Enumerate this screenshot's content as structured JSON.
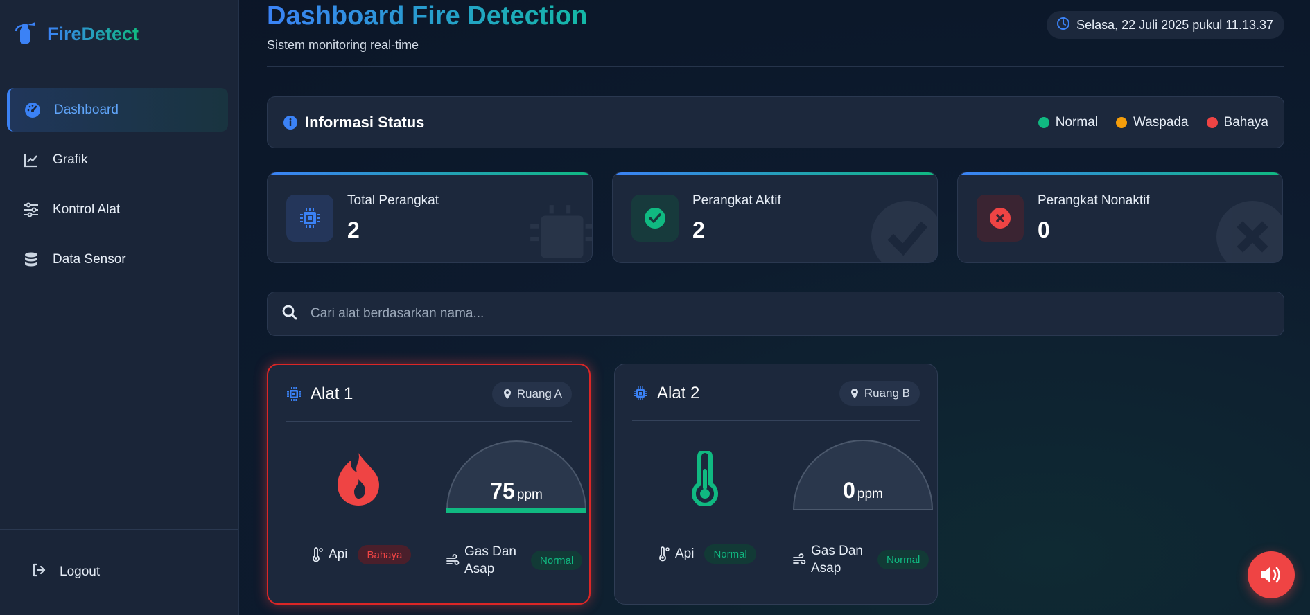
{
  "brand": {
    "name": "FireDetect"
  },
  "sidebar": {
    "items": [
      {
        "label": "Dashboard",
        "icon": "gauge-icon",
        "active": true
      },
      {
        "label": "Grafik",
        "icon": "chart-line-icon"
      },
      {
        "label": "Kontrol Alat",
        "icon": "sliders-icon"
      },
      {
        "label": "Data Sensor",
        "icon": "database-icon"
      }
    ],
    "logout_label": "Logout"
  },
  "header": {
    "title": "Dashboard Fire Detection",
    "subtitle": "Sistem monitoring real-time",
    "datetime": "Selasa, 22 Juli 2025 pukul 11.13.37"
  },
  "status_info": {
    "title": "Informasi Status",
    "legend": [
      {
        "label": "Normal",
        "color": "#10b981"
      },
      {
        "label": "Waspada",
        "color": "#f59e0b"
      },
      {
        "label": "Bahaya",
        "color": "#ef4444"
      }
    ]
  },
  "stats": [
    {
      "label": "Total Perangkat",
      "value": "2",
      "icon": "chip-icon"
    },
    {
      "label": "Perangkat Aktif",
      "value": "2",
      "icon": "check-circle-icon"
    },
    {
      "label": "Perangkat Nonaktif",
      "value": "0",
      "icon": "x-circle-icon"
    }
  ],
  "search": {
    "placeholder": "Cari alat berdasarkan nama..."
  },
  "devices": [
    {
      "name": "Alat 1",
      "location": "Ruang A",
      "main_icon": "fire-icon",
      "gas_value": "75",
      "gas_unit": "ppm",
      "fire_label": "Api",
      "fire_status": "Bahaya",
      "gas_label": "Gas Dan Asap",
      "gas_status": "Normal"
    },
    {
      "name": "Alat 2",
      "location": "Ruang B",
      "main_icon": "thermometer-icon",
      "gas_value": "0",
      "gas_unit": "ppm",
      "fire_label": "Api",
      "fire_status": "Normal",
      "gas_label": "Gas Dan Asap",
      "gas_status": "Normal"
    }
  ],
  "colors": {
    "accent_blue": "#3b82f6",
    "accent_green": "#10b981",
    "danger": "#ef4444",
    "warning": "#f59e0b"
  }
}
